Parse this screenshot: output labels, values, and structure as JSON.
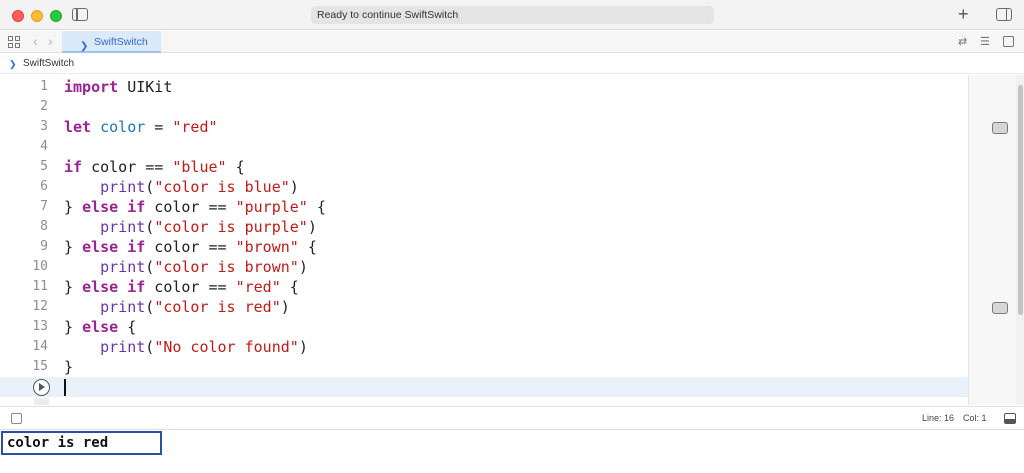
{
  "window": {
    "activity_text": "Ready to continue SwiftSwitch",
    "plus_label": "+"
  },
  "tabbar": {
    "back_glyph": "‹",
    "forward_glyph": "›",
    "active_tab": "SwiftSwitch",
    "swift_glyph": "❯",
    "swap_glyph": "⇄",
    "adjust_glyph": "☰"
  },
  "breadcrumb": {
    "glyph": "❯",
    "label": "SwiftSwitch"
  },
  "editor": {
    "lines": [
      {
        "n": "1",
        "tokens": [
          [
            "kw",
            "import"
          ],
          [
            "t",
            " UIKit"
          ]
        ]
      },
      {
        "n": "2",
        "tokens": []
      },
      {
        "n": "3",
        "tokens": [
          [
            "kw",
            "let"
          ],
          [
            "t",
            " "
          ],
          [
            "var",
            "color"
          ],
          [
            "t",
            " = "
          ],
          [
            "str",
            "\"red\""
          ]
        ]
      },
      {
        "n": "4",
        "tokens": []
      },
      {
        "n": "5",
        "tokens": [
          [
            "kw",
            "if"
          ],
          [
            "t",
            " color == "
          ],
          [
            "str",
            "\"blue\""
          ],
          [
            "t",
            " {"
          ]
        ]
      },
      {
        "n": "6",
        "tokens": [
          [
            "t",
            "    "
          ],
          [
            "fn",
            "print"
          ],
          [
            "t",
            "("
          ],
          [
            "str",
            "\"color is blue\""
          ],
          [
            "t",
            ")"
          ]
        ]
      },
      {
        "n": "7",
        "tokens": [
          [
            "t",
            "} "
          ],
          [
            "kw",
            "else if"
          ],
          [
            "t",
            " color == "
          ],
          [
            "str",
            "\"purple\""
          ],
          [
            "t",
            " {"
          ]
        ]
      },
      {
        "n": "8",
        "tokens": [
          [
            "t",
            "    "
          ],
          [
            "fn",
            "print"
          ],
          [
            "t",
            "("
          ],
          [
            "str",
            "\"color is purple\""
          ],
          [
            "t",
            ")"
          ]
        ]
      },
      {
        "n": "9",
        "tokens": [
          [
            "t",
            "} "
          ],
          [
            "kw",
            "else if"
          ],
          [
            "t",
            " color == "
          ],
          [
            "str",
            "\"brown\""
          ],
          [
            "t",
            " {"
          ]
        ]
      },
      {
        "n": "10",
        "tokens": [
          [
            "t",
            "    "
          ],
          [
            "fn",
            "print"
          ],
          [
            "t",
            "("
          ],
          [
            "str",
            "\"color is brown\""
          ],
          [
            "t",
            ")"
          ]
        ]
      },
      {
        "n": "11",
        "tokens": [
          [
            "t",
            "} "
          ],
          [
            "kw",
            "else if"
          ],
          [
            "t",
            " color == "
          ],
          [
            "str",
            "\"red\""
          ],
          [
            "t",
            " {"
          ]
        ]
      },
      {
        "n": "12",
        "tokens": [
          [
            "t",
            "    "
          ],
          [
            "fn",
            "print"
          ],
          [
            "t",
            "("
          ],
          [
            "str",
            "\"color is red\""
          ],
          [
            "t",
            ")"
          ]
        ]
      },
      {
        "n": "13",
        "tokens": [
          [
            "t",
            "} "
          ],
          [
            "kw",
            "else"
          ],
          [
            "t",
            " {"
          ]
        ]
      },
      {
        "n": "14",
        "tokens": [
          [
            "t",
            "    "
          ],
          [
            "fn",
            "print"
          ],
          [
            "t",
            "("
          ],
          [
            "str",
            "\"No color found\""
          ],
          [
            "t",
            ")"
          ]
        ]
      },
      {
        "n": "15",
        "tokens": [
          [
            "t",
            "}"
          ]
        ]
      }
    ]
  },
  "status": {
    "line": "Line: 16",
    "col": "Col: 1"
  },
  "console": {
    "output": "color is red"
  },
  "colors": {
    "keyword": "#9b2393",
    "string": "#c41a16",
    "variable": "#1f76b7",
    "function": "#6c36a9",
    "accent": "#2c6bd6",
    "console_border": "#2b4ea8"
  }
}
